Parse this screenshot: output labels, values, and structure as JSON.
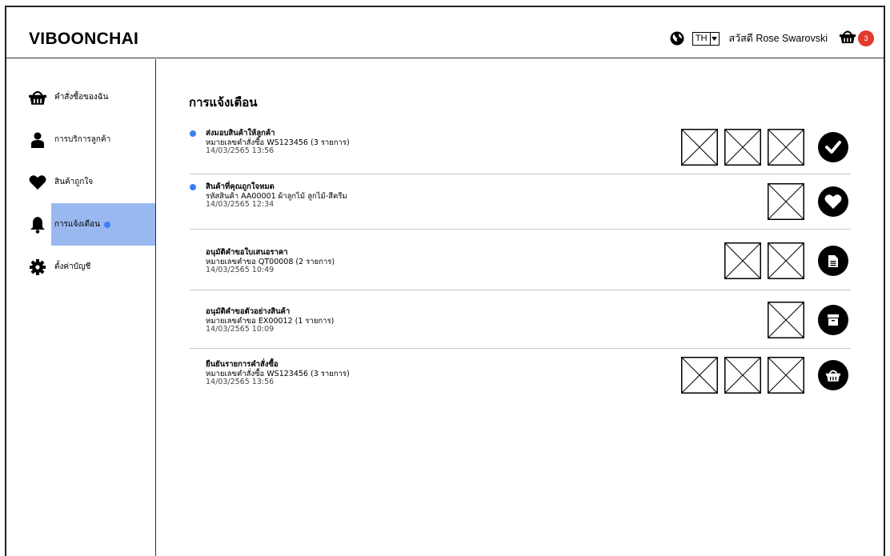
{
  "header": {
    "logo": "VIBOONCHAI",
    "lang": "TH",
    "greeting": "สวัสดี Rose Swarovski",
    "cart_count": "3",
    "icons": {
      "globe": "globe-icon",
      "caret": "caret-down-icon",
      "cart": "basket-icon"
    }
  },
  "sidebar": {
    "items": [
      {
        "label": "คำสั่งซื้อของฉัน",
        "icon": "basket-icon"
      },
      {
        "label": "การบริการลูกค้า",
        "icon": "person-icon"
      },
      {
        "label": "สินค้าถูกใจ",
        "icon": "heart-icon"
      },
      {
        "label": "การแจ้งเตือน",
        "icon": "bell-icon",
        "active": true,
        "unread": true
      },
      {
        "label": "ตั้งค่าบัญชี",
        "icon": "gear-icon"
      }
    ]
  },
  "main": {
    "title": "การแจ้งเตือน",
    "notifications": [
      {
        "title": "ส่งมอบสินค้าให้ลูกค้า",
        "subtitle": "หมายเลขคำสั่งซื้อ WS123456 (3 รายการ)",
        "date": "14/03/2565 13:56",
        "unread": true,
        "thumbs": 3,
        "action_icon": "check-icon"
      },
      {
        "title": "สินค้าที่คุณถูกใจหมด",
        "subtitle": "รหัสสินค้า AA00001 ผ้าลูกไม้ ลูกไม้-สีครีม",
        "date": "14/03/2565 12:34",
        "unread": true,
        "thumbs": 1,
        "action_icon": "heart-icon"
      },
      {
        "title": "อนุมัติคำขอใบเสนอราคา",
        "subtitle": "หมายเลขคำขอ QT00008 (2 รายการ)",
        "date": "14/03/2565 10:49",
        "unread": false,
        "thumbs": 2,
        "action_icon": "document-icon"
      },
      {
        "title": "อนุมัติคำขอตัวอย่างสินค้า",
        "subtitle": "หมายเลขคำขอ EX00012 (1 รายการ)",
        "date": "14/03/2565 10:09",
        "unread": false,
        "thumbs": 1,
        "action_icon": "box-icon"
      },
      {
        "title": "ยืนยันรายการคำสั่งซื้อ",
        "subtitle": "หมายเลขคำสั่งซื้อ WS123456 (3 รายการ)",
        "date": "14/03/2565 13:56",
        "unread": false,
        "thumbs": 3,
        "action_icon": "basket-icon"
      }
    ]
  },
  "colors": {
    "accent": "#9ab8f0",
    "unread_dot": "#3b7ff2",
    "badge": "#e23b2e"
  }
}
